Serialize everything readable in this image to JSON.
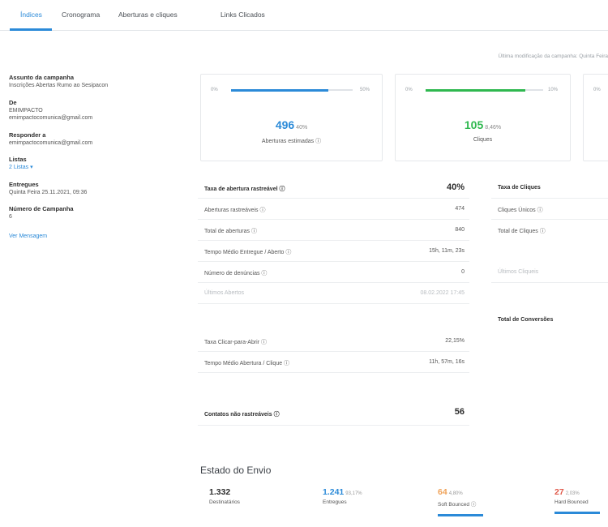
{
  "tabs": [
    {
      "label": "Índices",
      "active": true
    },
    {
      "label": "Cronograma"
    },
    {
      "label": "Aberturas e cliques"
    },
    {
      "label": "Links Clicados"
    }
  ],
  "top_note": "Última modificação da campanha: Quinta Feira",
  "sidebar": {
    "assunto_label": "Assunto da campanha",
    "assunto_value": "Inscrições Abertas Rumo ao Sesipacon",
    "de_label": "De",
    "de_name": "EMIMPACTO",
    "de_email": "emimpactocomunica@gmail.com",
    "responder_label": "Responder a",
    "responder_email": "emimpactocomunica@gmail.com",
    "listas_label": "Listas",
    "listas_link": "2 Listas ▾",
    "entregues_label": "Entregues",
    "entregues_value": "Quinta Feira 25.11.2021, 09:36",
    "numero_label": "Número de Campanha",
    "numero_value": "6",
    "ver_mensagem": "Ver Mensagem"
  },
  "cards": [
    {
      "min": "0%",
      "max": "50%",
      "value": "496",
      "pct": "40%",
      "sub": "Aberturas estimadas ⓘ",
      "fill": 0.8,
      "color": "#2b8ad8"
    },
    {
      "min": "0%",
      "max": "10%",
      "value": "105",
      "pct": "8,46%",
      "sub": "Cliques",
      "fill": 0.85,
      "color": "#2fb84f"
    },
    {
      "min": "0%"
    }
  ],
  "stats": {
    "head": {
      "k": "Taxa de abertura rastreável ⓘ",
      "v": "40%"
    },
    "rows": [
      {
        "k": "Aberturas rastreáveis ⓘ",
        "v": "474"
      },
      {
        "k": "Total de aberturas ⓘ",
        "v": "840"
      },
      {
        "k": "Tempo Médio Entregue / Aberto ⓘ",
        "v": "15h, 11m, 23s"
      },
      {
        "k": "Número de denúncias ⓘ",
        "v": "0"
      },
      {
        "k": "Últimos Abertos",
        "v": "08.02.2022 17:45"
      }
    ],
    "ctor": [
      {
        "k": "Taxa Clicar-para-Abrir ⓘ",
        "v": "22,15%"
      },
      {
        "k": "Tempo Médio Abertura / Clique ⓘ",
        "v": "11h, 57m, 16s"
      }
    ],
    "contatos": {
      "k": "Contatos não rastreáveis ⓘ",
      "v": "56"
    }
  },
  "right": {
    "head": "Taxa de Cliques",
    "rows": [
      "Cliques Únicos ⓘ",
      "Total de Cliques ⓘ"
    ],
    "ultimos": "Últimos Cliqueis",
    "conversoes": "Total de Conversões"
  },
  "envio": {
    "title": "Estado do Envio",
    "items": [
      {
        "value": "1.332",
        "pct": "",
        "label": "Destinatários",
        "color": "#2d2d2d",
        "bar": ""
      },
      {
        "value": "1.241",
        "pct": "93,17%",
        "label": "Entregues",
        "color": "#2b8ad8",
        "bar": ""
      },
      {
        "value": "64",
        "pct": "4,80%",
        "label": "Soft Bounced ⓘ",
        "color": "#f0a35a",
        "bar": "#2b8ad8"
      },
      {
        "value": "27",
        "pct": "2,03%",
        "label": "Hard Bounced",
        "color": "#e0594a",
        "bar": "#2b8ad8"
      }
    ]
  }
}
